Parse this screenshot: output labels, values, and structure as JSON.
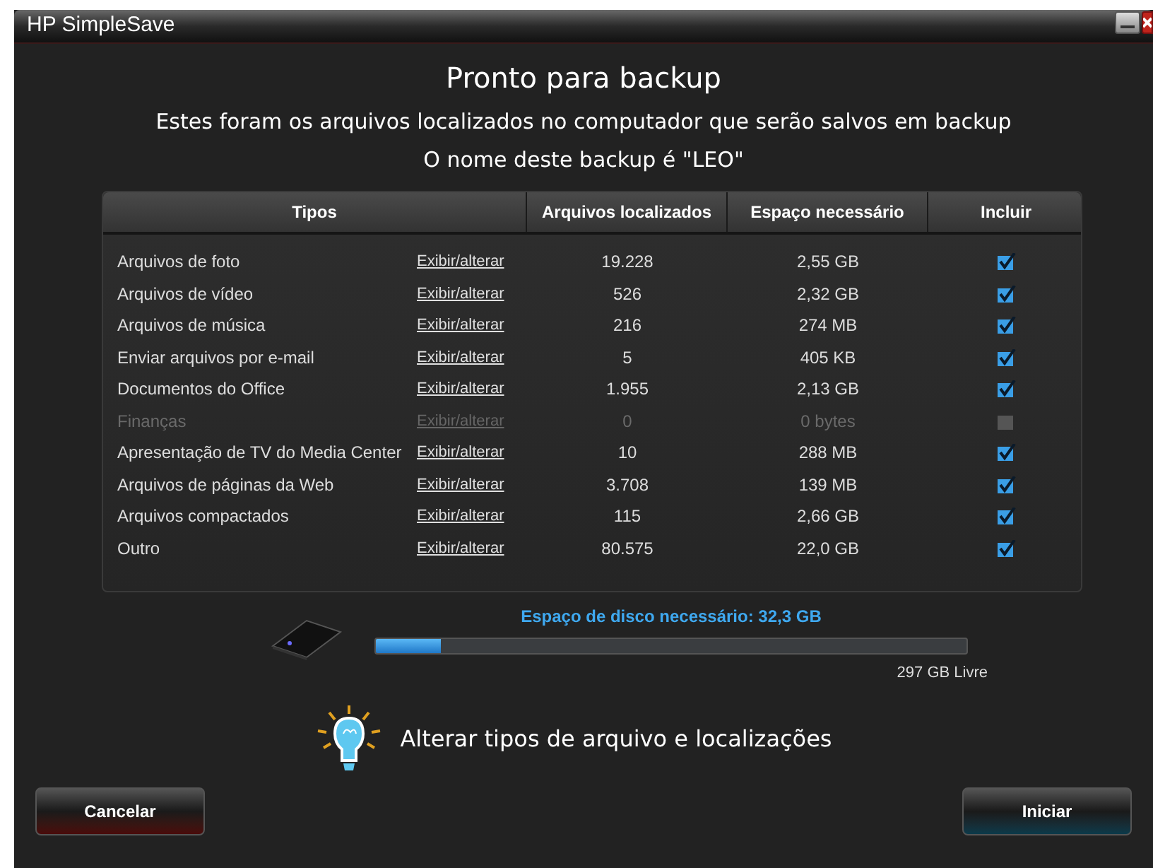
{
  "window": {
    "title": "HP SimpleSave"
  },
  "heading": "Pronto para backup",
  "subtitle": "Estes foram os arquivos localizados no computador que serão salvos em backup",
  "backup_name": "O nome deste backup é \"LEO\"",
  "table": {
    "columns": [
      "Tipos",
      "Arquivos localizados",
      "Espaço necessário",
      "Incluir"
    ],
    "rows": [
      {
        "type": "Arquivos de foto",
        "link": "Exibir/alterar",
        "count": "19.228",
        "size": "2,55 GB",
        "checked": true,
        "disabled": false
      },
      {
        "type": "Arquivos de vídeo",
        "link": "Exibir/alterar",
        "count": "526",
        "size": "2,32 GB",
        "checked": true,
        "disabled": false
      },
      {
        "type": "Arquivos de música",
        "link": "Exibir/alterar",
        "count": "216",
        "size": "274 MB",
        "checked": true,
        "disabled": false
      },
      {
        "type": "Enviar arquivos por e-mail",
        "link": "Exibir/alterar",
        "count": "5",
        "size": "405 KB",
        "checked": true,
        "disabled": false
      },
      {
        "type": "Documentos do Office",
        "link": "Exibir/alterar",
        "count": "1.955",
        "size": "2,13 GB",
        "checked": true,
        "disabled": false
      },
      {
        "type": "Finanças",
        "link": "Exibir/alterar",
        "count": "0",
        "size": "0 bytes",
        "checked": false,
        "disabled": true
      },
      {
        "type": "Apresentação de TV do Media Center",
        "link": "Exibir/alterar",
        "count": "10",
        "size": "288 MB",
        "checked": true,
        "disabled": false
      },
      {
        "type": "Arquivos de páginas da Web",
        "link": "Exibir/alterar",
        "count": "3.708",
        "size": "139 MB",
        "checked": true,
        "disabled": false
      },
      {
        "type": "Arquivos compactados",
        "link": "Exibir/alterar",
        "count": "115",
        "size": "2,66 GB",
        "checked": true,
        "disabled": false
      },
      {
        "type": "Outro",
        "link": "Exibir/alterar",
        "count": "80.575",
        "size": "22,0 GB",
        "checked": true,
        "disabled": false
      }
    ]
  },
  "disk": {
    "label": "Espaço de disco necessário: 32,3 GB",
    "level": 0.11,
    "free": "297 GB Livre"
  },
  "change_link": "Alterar tipos de arquivo e localizações",
  "buttons": [
    "Cancelar",
    "Iniciar"
  ]
}
